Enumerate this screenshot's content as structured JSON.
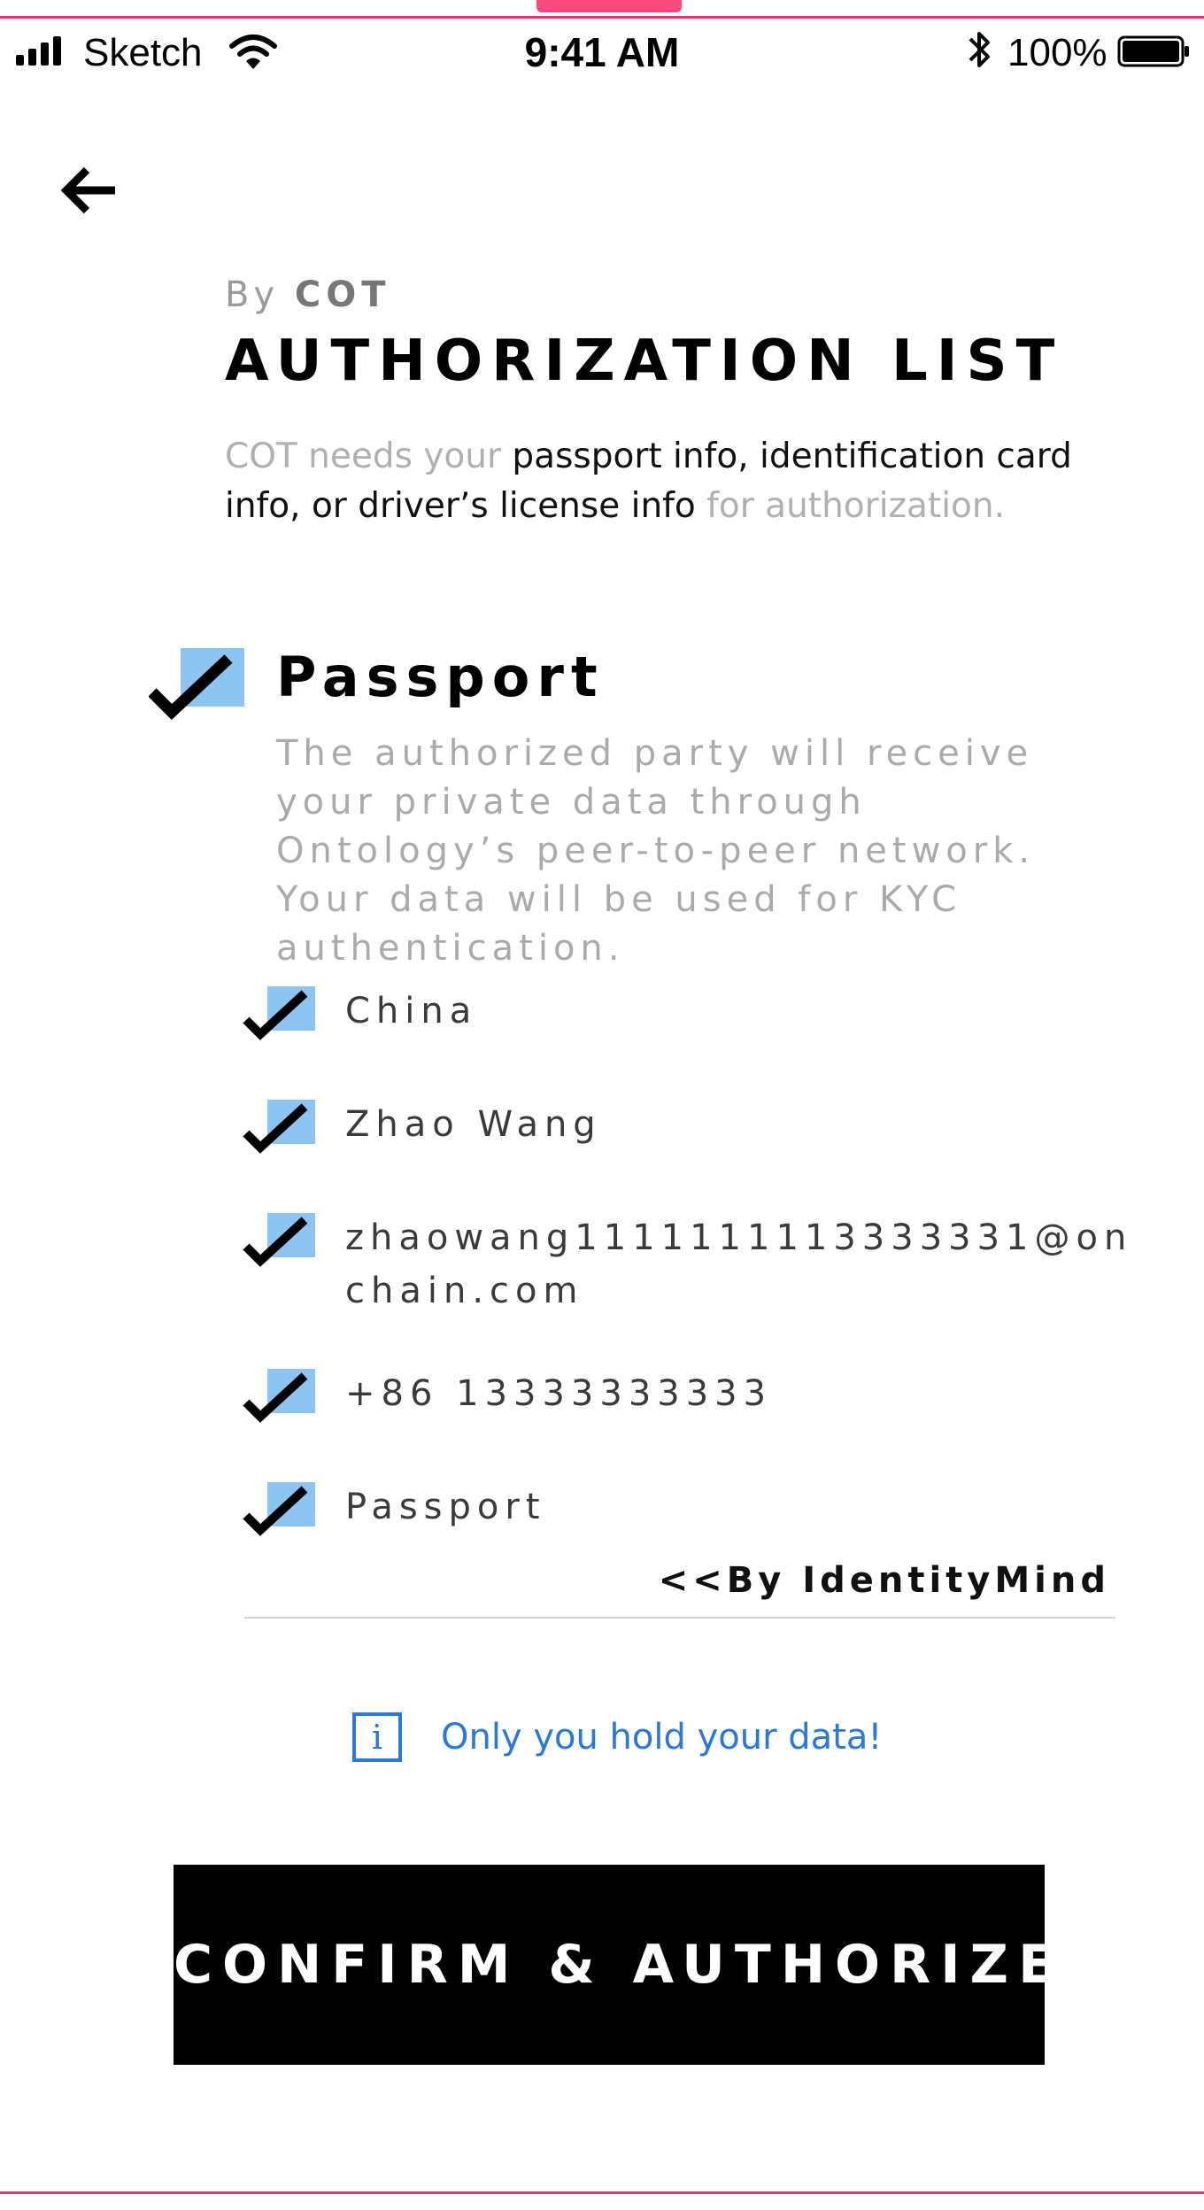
{
  "status_bar": {
    "carrier": "Sketch",
    "time": "9:41 AM",
    "battery": "100%",
    "icons": [
      "signal-icon",
      "wifi-icon",
      "bluetooth-icon",
      "battery-icon"
    ]
  },
  "nav": {
    "back_icon": "arrow-left-icon"
  },
  "header": {
    "by_prefix": "By",
    "by_name": "COT",
    "title": "AUTHORIZATION LIST"
  },
  "intro": {
    "part1": "COT needs your ",
    "part2": "passport info, identification card info, or driver’s license info",
    "part3": " for authorization."
  },
  "section": {
    "title": "Passport",
    "description": "The authorized party will receive your private data through Ontology’s peer-to-peer network. Your data will be used for KYC authentication.",
    "checked": true
  },
  "items": [
    {
      "label": "China",
      "checked": true
    },
    {
      "label": "Zhao Wang",
      "checked": true
    },
    {
      "label": "zhaowang1111111113333331@onchain.com",
      "checked": true
    },
    {
      "label": "+86 13333333333",
      "checked": true
    },
    {
      "label": "Passport",
      "checked": true
    }
  ],
  "attribution": "<<By IdentityMind",
  "notice": {
    "icon": "info-icon",
    "icon_glyph": "i",
    "text": "Only you hold your data!"
  },
  "actions": {
    "confirm_label": "CONFIRM & AUTHORIZE"
  },
  "colors": {
    "accent_blue": "#2d78d6",
    "check_fill": "#8ec4f2",
    "frame_pink": "#e5326c",
    "button_bg": "#000000"
  }
}
